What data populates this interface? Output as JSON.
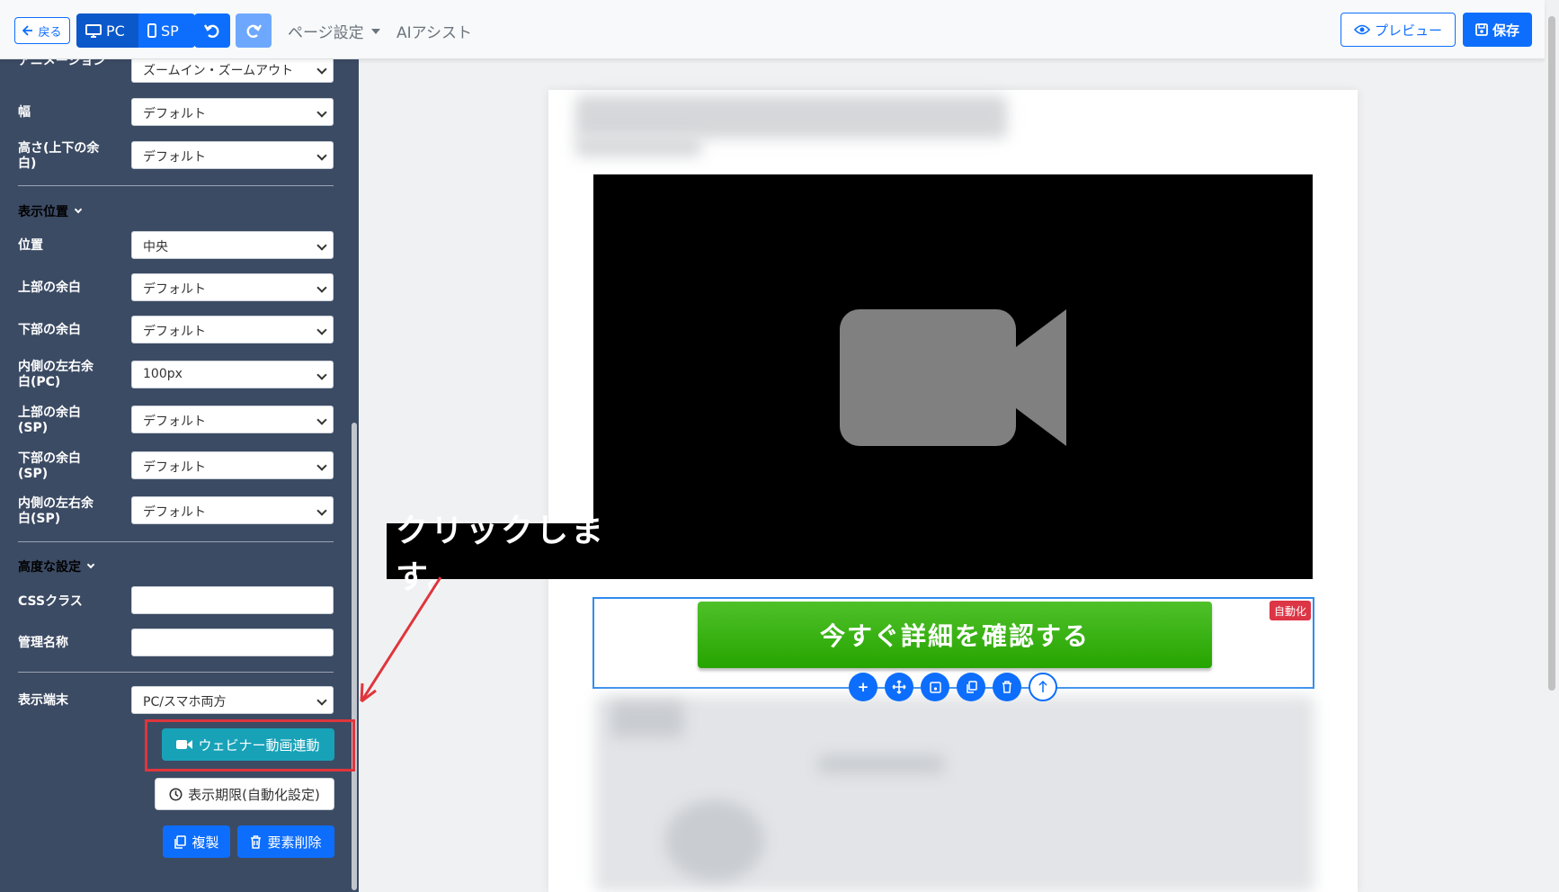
{
  "toolbar": {
    "back_label": "戻る",
    "device_pc_label": "PC",
    "device_sp_label": "SP",
    "page_settings_label": "ページ設定",
    "ai_assist_label": "AIアシスト",
    "preview_label": "プレビュー",
    "save_label": "保存"
  },
  "sidebar": {
    "animation_label": "アニメーション",
    "animation_value": "ズームイン・ズームアウト",
    "width_label": "幅",
    "width_value": "デフォルト",
    "height_label": "高さ(上下の余白)",
    "height_value": "デフォルト",
    "position_section": "表示位置",
    "position_label": "位置",
    "position_value": "中央",
    "top_margin_label": "上部の余白",
    "top_margin_value": "デフォルト",
    "bottom_margin_label": "下部の余白",
    "bottom_margin_value": "デフォルト",
    "inner_pc_label": "内側の左右余白(PC)",
    "inner_pc_value": "100px",
    "top_margin_sp_label": "上部の余白(SP)",
    "top_margin_sp_value": "デフォルト",
    "bottom_margin_sp_label": "下部の余白(SP)",
    "bottom_margin_sp_value": "デフォルト",
    "inner_sp_label": "内側の左右余白(SP)",
    "inner_sp_value": "デフォルト",
    "advanced_section": "高度な設定",
    "css_class_label": "CSSクラス",
    "admin_name_label": "管理名称",
    "device_label": "表示端末",
    "device_value": "PC/スマホ両方",
    "webinar_button": "ウェビナー動画連動",
    "period_button": "表示期限(自動化設定)",
    "copy_button": "複製",
    "delete_button": "要素削除"
  },
  "canvas": {
    "annotation": "クリックします。",
    "cta_text": "今すぐ詳細を確認する",
    "auto_badge": "自動化"
  },
  "colors": {
    "primary": "#0d6efd",
    "sidebar_bg": "#3c4b64",
    "webinar_btn": "#17a2b8",
    "cta_green": "#26a400",
    "highlight_red": "#e0353c"
  }
}
